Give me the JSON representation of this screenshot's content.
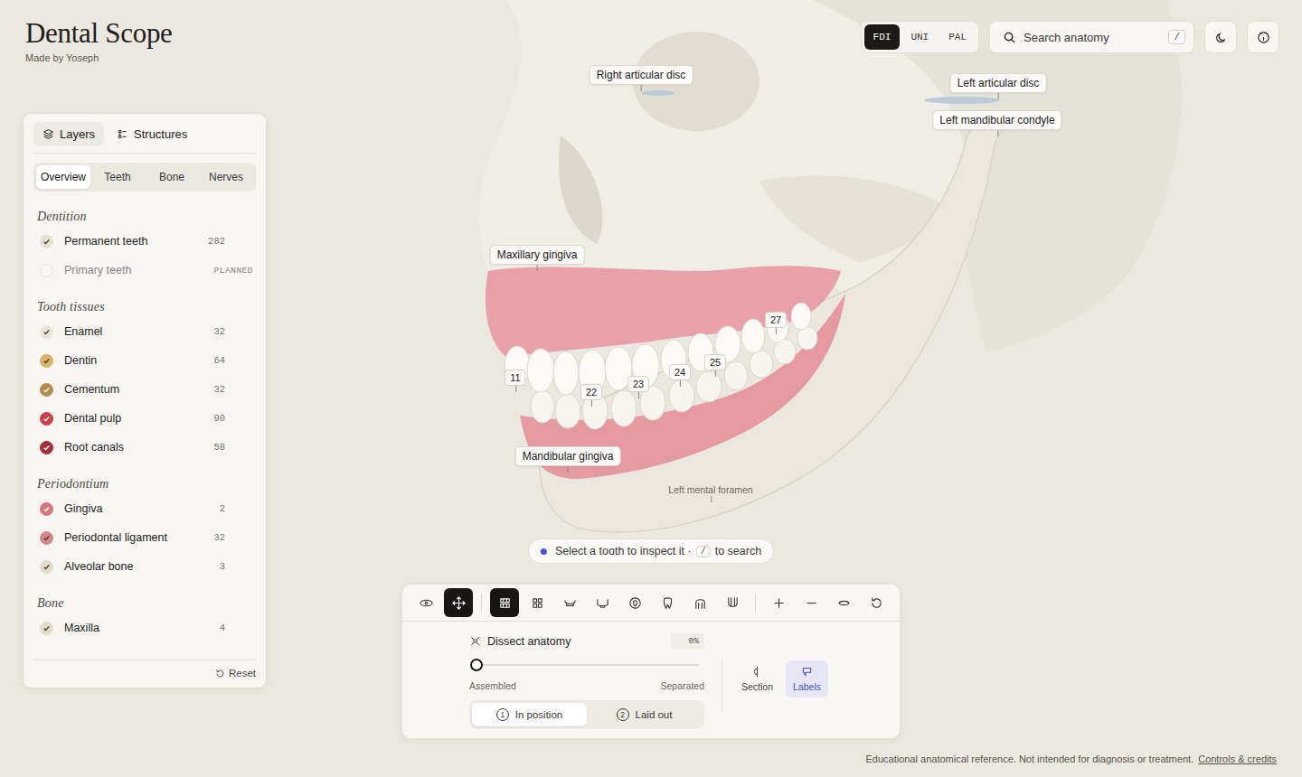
{
  "app": {
    "title": "Dental Scope",
    "byline": "Made by Yoseph"
  },
  "numbering": [
    {
      "label": "FDI",
      "selected": true
    },
    {
      "label": "UNI",
      "selected": false
    },
    {
      "label": "PAL",
      "selected": false
    }
  ],
  "search": {
    "placeholder": "Search anatomy",
    "shortcut": "/"
  },
  "panel": {
    "tabs": [
      {
        "label": "Layers",
        "selected": true
      },
      {
        "label": "Structures",
        "selected": false
      }
    ],
    "filters": [
      {
        "label": "Overview",
        "selected": true
      },
      {
        "label": "Teeth",
        "selected": false
      },
      {
        "label": "Bone",
        "selected": false
      },
      {
        "label": "Nerves",
        "selected": false
      }
    ],
    "groups": [
      {
        "title": "Dentition",
        "items": [
          {
            "name": "Permanent teeth",
            "count": "282",
            "checked": true,
            "disabled": false,
            "color": "#e6e0d1"
          },
          {
            "name": "Primary teeth",
            "count": "PLANNED",
            "checked": false,
            "disabled": true,
            "color": "#e4e0d8"
          }
        ]
      },
      {
        "title": "Tooth tissues",
        "items": [
          {
            "name": "Enamel",
            "count": "32",
            "checked": true,
            "disabled": false,
            "color": "#ebe6da"
          },
          {
            "name": "Dentin",
            "count": "64",
            "checked": true,
            "disabled": false,
            "color": "#d9b36a"
          },
          {
            "name": "Cementum",
            "count": "32",
            "checked": true,
            "disabled": false,
            "color": "#b58a4e"
          },
          {
            "name": "Dental pulp",
            "count": "90",
            "checked": true,
            "disabled": false,
            "color": "#c9404a"
          },
          {
            "name": "Root canals",
            "count": "58",
            "checked": true,
            "disabled": false,
            "color": "#a32f3a"
          }
        ]
      },
      {
        "title": "Periodontium",
        "items": [
          {
            "name": "Gingiva",
            "count": "2",
            "checked": true,
            "disabled": false,
            "color": "#d7767d"
          },
          {
            "name": "Periodontal ligament",
            "count": "32",
            "checked": true,
            "disabled": false,
            "color": "#d5878a"
          },
          {
            "name": "Alveolar bone",
            "count": "3",
            "checked": true,
            "disabled": false,
            "color": "#e3dccb"
          }
        ]
      },
      {
        "title": "Bone",
        "items": [
          {
            "name": "Maxilla",
            "count": "4",
            "checked": true,
            "disabled": false,
            "color": "#e3dccb"
          }
        ]
      }
    ],
    "reset": "Reset"
  },
  "scene": {
    "labels": [
      {
        "text": "Right articular disc",
        "kind": "callout"
      },
      {
        "text": "Left articular disc",
        "kind": "callout"
      },
      {
        "text": "Left mandibular condyle",
        "kind": "callout"
      },
      {
        "text": "Maxillary gingiva",
        "kind": "callout"
      },
      {
        "text": "Mandibular gingiva",
        "kind": "callout"
      },
      {
        "text": "Left mental foramen",
        "kind": "plain"
      }
    ],
    "tooth_tags": [
      "11",
      "22",
      "23",
      "24",
      "25",
      "27"
    ]
  },
  "hint": {
    "text": "Select a tooth to inspect it ·",
    "key": "/",
    "suffix": "to search"
  },
  "toolbar": {
    "groups": [
      [
        {
          "selected": false
        },
        {
          "selected": true
        }
      ],
      [
        {
          "selected": true
        },
        {
          "selected": false
        },
        {
          "selected": false
        },
        {
          "selected": false
        },
        {
          "selected": false
        },
        {
          "selected": false
        },
        {
          "selected": false
        },
        {
          "selected": false
        }
      ],
      [
        {
          "selected": false
        },
        {
          "selected": false
        },
        {
          "selected": false
        },
        {
          "selected": false
        }
      ]
    ]
  },
  "dissect": {
    "title": "Dissect anatomy",
    "reading": "0%",
    "level": 0,
    "min_label": "Assembled",
    "max_label": "Separated",
    "modes": [
      {
        "num": "1",
        "label": "In position",
        "selected": true
      },
      {
        "num": "2",
        "label": "Laid out",
        "selected": false
      }
    ]
  },
  "view_toggles": [
    {
      "label": "Section",
      "selected": false
    },
    {
      "label": "Labels",
      "selected": true
    }
  ],
  "footer": {
    "note": "Educational anatomical reference. Not intended for diagnosis or treatment.",
    "link": "Controls & credits"
  }
}
